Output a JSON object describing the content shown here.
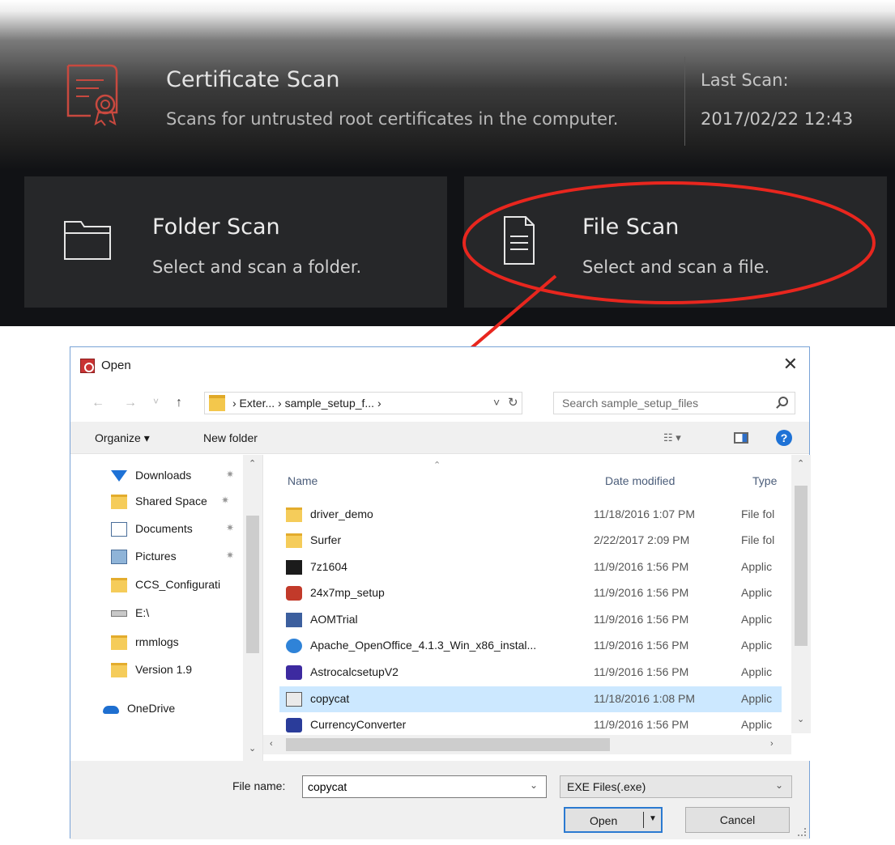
{
  "scan_panel": {
    "certificate": {
      "title": "Certificate Scan",
      "description": "Scans for untrusted root certificates in the computer.",
      "last_scan_label": "Last Scan:",
      "last_scan_date": "2017/02/22 12:43"
    },
    "folder_scan": {
      "title": "Folder Scan",
      "description": "Select and scan a folder."
    },
    "file_scan": {
      "title": "File Scan",
      "description": "Select and scan a file."
    },
    "colors": {
      "accent_red": "#cc4a3f",
      "highlight_red": "#e8261e",
      "tile_bg": "#262729"
    }
  },
  "dialog": {
    "title": "Open",
    "close_glyph": "✕",
    "nav": {
      "back": "←",
      "forward": "→",
      "recent": "˅",
      "up": "↑"
    },
    "address": {
      "path": "›  Exter...  ›  sample_setup_f...  ›",
      "dropdown_glyph": "˅",
      "refresh_glyph": "↻"
    },
    "search": {
      "placeholder": "Search sample_setup_files"
    },
    "toolbar": {
      "organize": "Organize ▾",
      "new_folder": "New folder",
      "view_glyph": "☷ ▾",
      "help": "?"
    },
    "nav_pane": {
      "items": [
        {
          "label": "Downloads",
          "icon": "download-arrow-icon",
          "pinned": true
        },
        {
          "label": "Shared Space",
          "icon": "folder-icon",
          "pinned": true
        },
        {
          "label": "Documents",
          "icon": "documents-icon",
          "pinned": true
        },
        {
          "label": "Pictures",
          "icon": "pictures-icon",
          "pinned": true
        },
        {
          "label": "CCS_Configurati",
          "icon": "folder-icon",
          "pinned": false
        },
        {
          "label": "E:\\",
          "icon": "drive-icon",
          "pinned": false
        },
        {
          "label": "rmmlogs",
          "icon": "folder-icon",
          "pinned": false
        },
        {
          "label": "Version 1.9",
          "icon": "folder-icon",
          "pinned": false
        },
        {
          "label": "OneDrive",
          "icon": "onedrive-icon",
          "pinned": false
        }
      ],
      "pin_glyph": "✷"
    },
    "file_list": {
      "columns": {
        "name": "Name",
        "date": "Date modified",
        "type": "Type"
      },
      "rows": [
        {
          "name": "driver_demo",
          "date": "11/18/2016 1:07 PM",
          "type": "File fol",
          "icon": "folder-icon"
        },
        {
          "name": "Surfer",
          "date": "2/22/2017 2:09 PM",
          "type": "File fol",
          "icon": "folder-icon"
        },
        {
          "name": "7z1604",
          "date": "11/9/2016 1:56 PM",
          "type": "Applic",
          "icon": "7zip-icon"
        },
        {
          "name": "24x7mp_setup",
          "date": "11/9/2016 1:56 PM",
          "type": "Applic",
          "icon": "setup-icon"
        },
        {
          "name": "AOMTrial",
          "date": "11/9/2016 1:56 PM",
          "type": "Applic",
          "icon": "app-window-icon"
        },
        {
          "name": "Apache_OpenOffice_4.1.3_Win_x86_instal...",
          "date": "11/9/2016 1:56 PM",
          "type": "Applic",
          "icon": "openoffice-icon"
        },
        {
          "name": "AstrocalcsetupV2",
          "date": "11/9/2016 1:56 PM",
          "type": "Applic",
          "icon": "installer-icon"
        },
        {
          "name": "copycat",
          "date": "11/18/2016 1:08 PM",
          "type": "Applic",
          "icon": "app-icon",
          "selected": true
        },
        {
          "name": "CurrencyConverter",
          "date": "11/9/2016 1:56 PM",
          "type": "Applic",
          "icon": "currency-icon"
        }
      ]
    },
    "footer": {
      "filename_label": "File name:",
      "filename_value": "copycat",
      "filetype": "EXE Files(.exe)",
      "open": "Open",
      "cancel": "Cancel"
    }
  }
}
